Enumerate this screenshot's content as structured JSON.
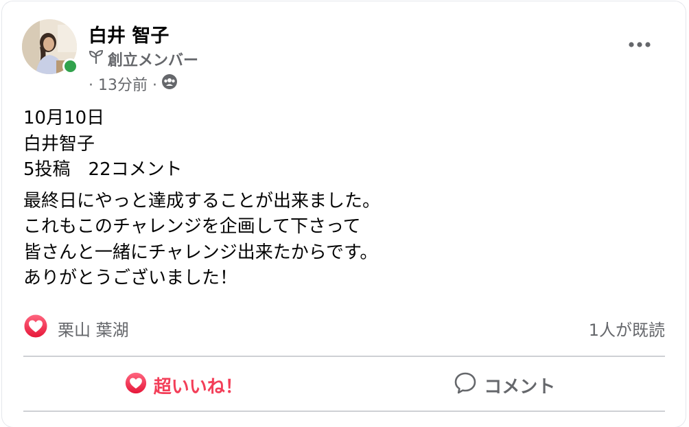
{
  "author": {
    "name": "白井 智子",
    "badge": "創立メンバー",
    "time": "· 13分前 ·",
    "avatar": "profile-photo"
  },
  "post": {
    "lines_1": [
      "10月10日",
      "白井智子",
      "5投稿　22コメント"
    ],
    "lines_2": [
      "最終日にやっと達成することが出来ました。",
      "これもこのチャレンジを企画して下さって",
      "皆さんと一緒にチャレンジ出来たからです。",
      "ありがとうございました！"
    ]
  },
  "reactions": {
    "reactor_name": "栗山 葉湖",
    "read_count": "1人が既読"
  },
  "actions": {
    "like_label": "超いいね！",
    "comment_label": "コメント"
  },
  "colors": {
    "accent_love": "#f33e58",
    "online": "#31a24c",
    "secondary_text": "#65676b"
  },
  "icons": {
    "badge": "sprout-icon",
    "privacy": "group-icon",
    "more": "more-horizontal-icon",
    "reaction": "heart-reaction-icon",
    "comment": "speech-bubble-icon"
  }
}
